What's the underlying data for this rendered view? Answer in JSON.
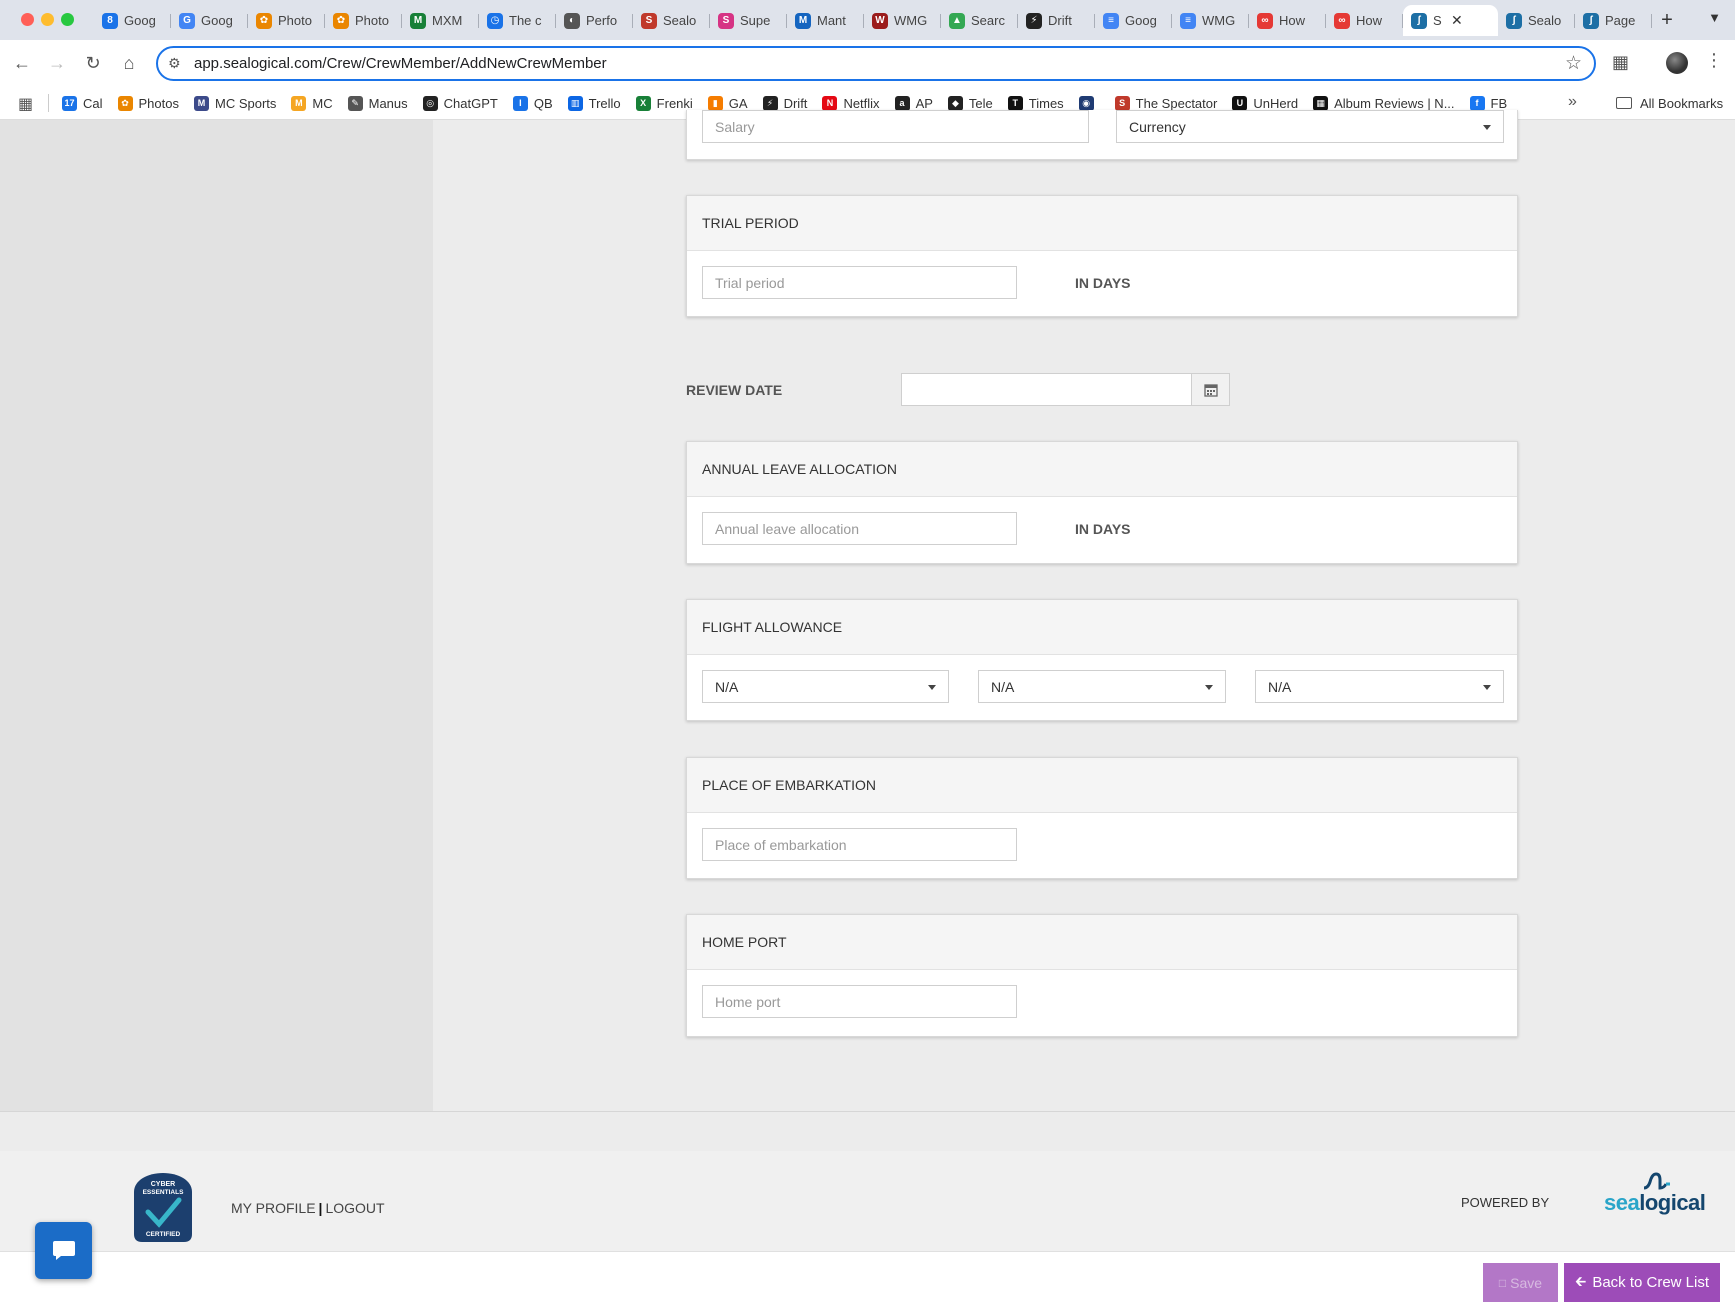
{
  "browser": {
    "url": "app.sealogical.com/Crew/CrewMember/AddNewCrewMember",
    "tabs": [
      {
        "label": "Goog",
        "color": "#1a73e8",
        "glyph": "8"
      },
      {
        "label": "Goog",
        "color": "#4285f4",
        "glyph": "G"
      },
      {
        "label": "Photo",
        "color": "#ea8600",
        "glyph": "✿"
      },
      {
        "label": "Photo",
        "color": "#ea8600",
        "glyph": "✿"
      },
      {
        "label": "MXM",
        "color": "#188038",
        "glyph": "M"
      },
      {
        "label": "The c",
        "color": "#1a73e8",
        "glyph": "◷"
      },
      {
        "label": "Perfo",
        "color": "#555555",
        "glyph": "◐"
      },
      {
        "label": "Sealo",
        "color": "#c0392b",
        "glyph": "S"
      },
      {
        "label": "Supe",
        "color": "#d63384",
        "glyph": "S"
      },
      {
        "label": "Mant",
        "color": "#1565c0",
        "glyph": "M"
      },
      {
        "label": "WMG",
        "color": "#9b1c1c",
        "glyph": "W"
      },
      {
        "label": "Searc",
        "color": "#34a853",
        "glyph": "▲"
      },
      {
        "label": "Drift",
        "color": "#222222",
        "glyph": "⚡"
      },
      {
        "label": "Goog",
        "color": "#4285f4",
        "glyph": "≡"
      },
      {
        "label": "WMG",
        "color": "#4285f4",
        "glyph": "≡"
      },
      {
        "label": "How",
        "color": "#e53935",
        "glyph": "∞"
      },
      {
        "label": "How",
        "color": "#e53935",
        "glyph": "∞"
      },
      {
        "label": "S",
        "color": "#1d6fa5",
        "glyph": "ʃ",
        "active": true
      },
      {
        "label": "Sealo",
        "color": "#1d6fa5",
        "glyph": "ʃ"
      },
      {
        "label": "Page",
        "color": "#1d6fa5",
        "glyph": "ʃ"
      }
    ]
  },
  "bookmarks": {
    "items": [
      {
        "label": "Cal",
        "color": "#1a73e8",
        "glyph": "17"
      },
      {
        "label": "Photos",
        "color": "#ea8600",
        "glyph": "✿"
      },
      {
        "label": "MC Sports",
        "color": "#3c4a8a",
        "glyph": "M"
      },
      {
        "label": "MC",
        "color": "#f5a623",
        "glyph": "M"
      },
      {
        "label": "Manus",
        "color": "#555555",
        "glyph": "✎"
      },
      {
        "label": "ChatGPT",
        "color": "#222222",
        "glyph": "◎"
      },
      {
        "label": "QB",
        "color": "#1a73e8",
        "glyph": "I"
      },
      {
        "label": "Trello",
        "color": "#0c66e4",
        "glyph": "▥"
      },
      {
        "label": "Frenki",
        "color": "#188038",
        "glyph": "X"
      },
      {
        "label": "GA",
        "color": "#f57c00",
        "glyph": "▮"
      },
      {
        "label": "Drift",
        "color": "#222222",
        "glyph": "⚡"
      },
      {
        "label": "Netflix",
        "color": "#e50914",
        "glyph": "N"
      },
      {
        "label": "AP",
        "color": "#222222",
        "glyph": "a"
      },
      {
        "label": "Tele",
        "color": "#222222",
        "glyph": "◆"
      },
      {
        "label": "Times",
        "color": "#111111",
        "glyph": "T"
      },
      {
        "label": "",
        "color": "#1f3b73",
        "glyph": "◉"
      },
      {
        "label": "The Spectator",
        "color": "#c0392b",
        "glyph": "S"
      },
      {
        "label": "UnHerd",
        "color": "#111111",
        "glyph": "U"
      },
      {
        "label": "Album Reviews | N...",
        "color": "#111111",
        "glyph": "▦"
      },
      {
        "label": "FB",
        "color": "#1877f2",
        "glyph": "f"
      }
    ],
    "all_label": "All Bookmarks"
  },
  "form": {
    "salary": {
      "placeholder": "Salary",
      "currency_value": "Currency"
    },
    "trial_period": {
      "title": "TRIAL PERIOD",
      "placeholder": "Trial period",
      "unit": "IN DAYS"
    },
    "review_date": {
      "label": "REVIEW DATE",
      "value": ""
    },
    "annual_leave": {
      "title": "ANNUAL LEAVE ALLOCATION",
      "placeholder": "Annual leave allocation",
      "unit": "IN DAYS"
    },
    "flight_allowance": {
      "title": "FLIGHT ALLOWANCE",
      "select_1": "N/A",
      "select_2": "N/A",
      "select_3": "N/A"
    },
    "place_of_embarkation": {
      "title": "PLACE OF EMBARKATION",
      "placeholder": "Place of embarkation"
    },
    "home_port": {
      "title": "HOME PORT",
      "placeholder": "Home port"
    }
  },
  "footer": {
    "badge_line1": "CYBER",
    "badge_line2": "ESSENTIALS",
    "badge_line3": "CERTIFIED",
    "my_profile": "MY PROFILE",
    "separator": "|",
    "logout": "LOGOUT",
    "powered_by": "POWERED BY",
    "logo_part1": "sea",
    "logo_part2": "logical"
  },
  "actions": {
    "save_label": "Save",
    "back_label": "Back to Crew List"
  },
  "colors": {
    "save_bg": "#b377c7",
    "back_bg": "#9d4cb8",
    "chat_bg": "#1b6cc7",
    "omnibox_focus": "#1a73e8"
  }
}
